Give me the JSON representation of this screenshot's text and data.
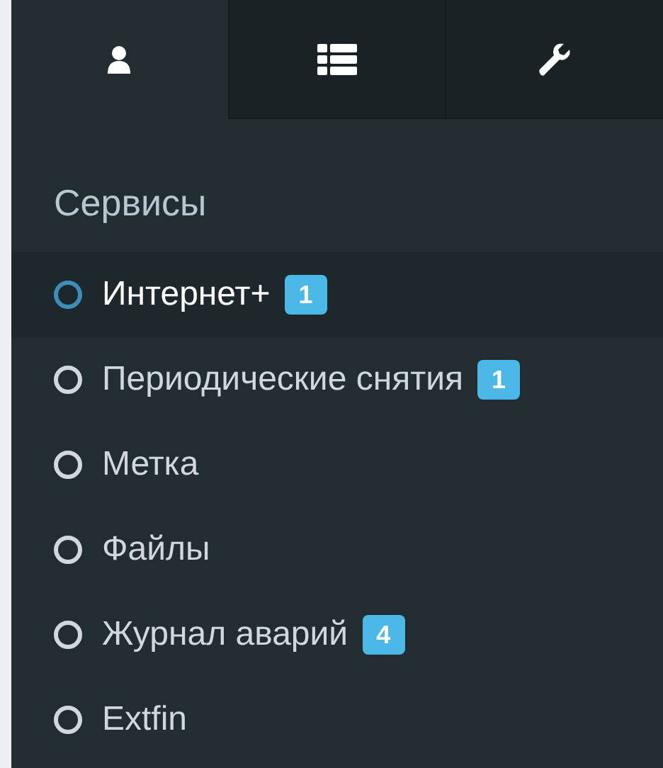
{
  "tabs": [
    {
      "kind": "user",
      "selected": true
    },
    {
      "kind": "list",
      "selected": false
    },
    {
      "kind": "wrench",
      "selected": false
    }
  ],
  "section_title": "Сервисы",
  "items": [
    {
      "label": "Интернет+",
      "badge": "1",
      "selected": true
    },
    {
      "label": "Периодические снятия",
      "badge": "1",
      "selected": false
    },
    {
      "label": "Метка",
      "selected": false
    },
    {
      "label": "Файлы",
      "selected": false
    },
    {
      "label": "Журнал аварий",
      "badge": "4",
      "selected": false
    },
    {
      "label": "Extfin",
      "selected": false
    }
  ]
}
